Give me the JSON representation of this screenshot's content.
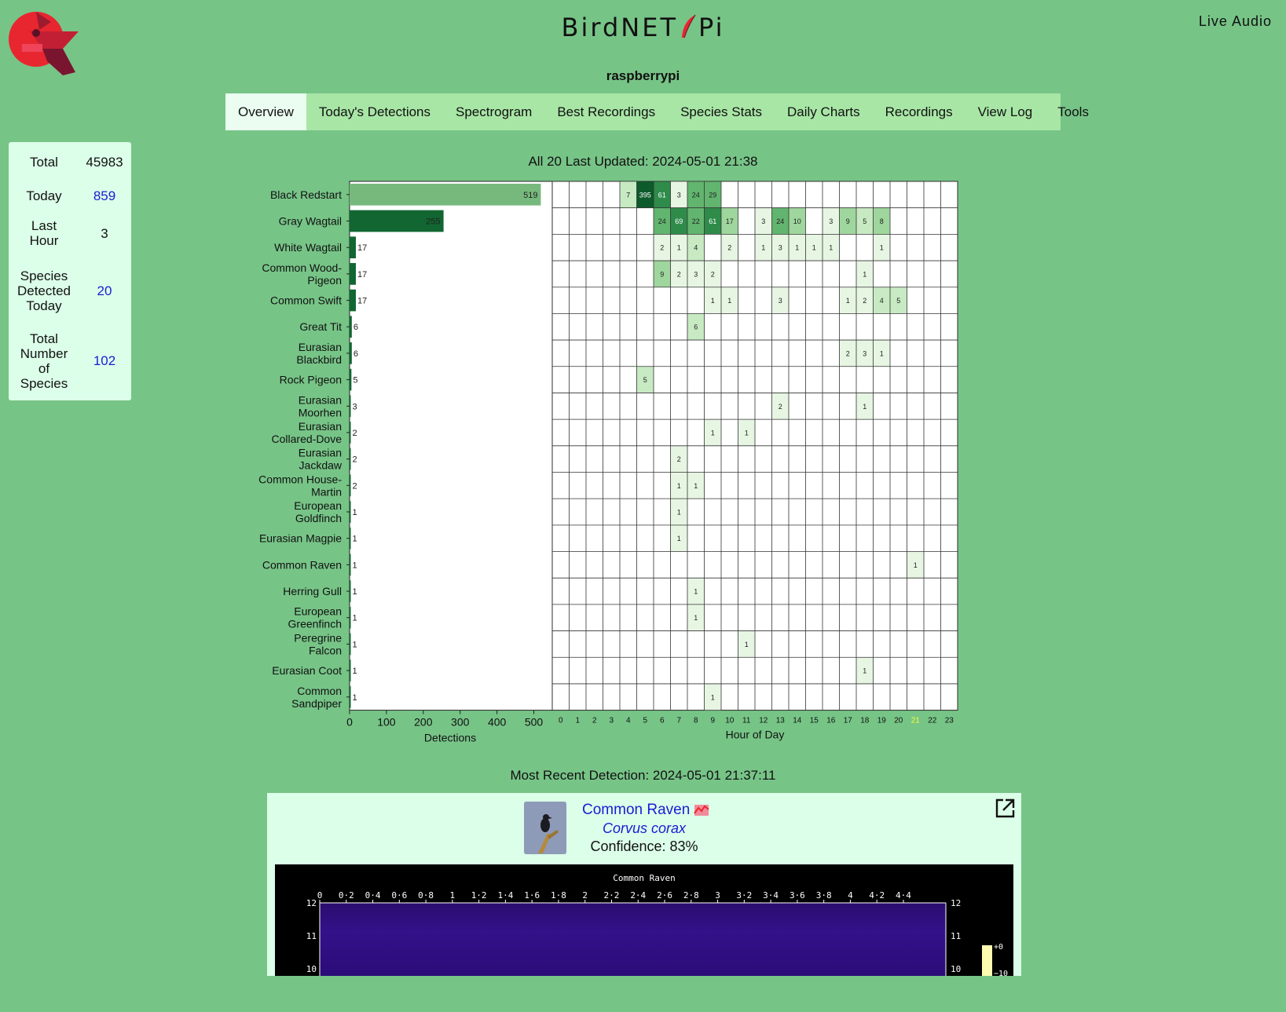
{
  "header": {
    "title_left": "BirdNET",
    "title_right": "Pi",
    "hostname": "raspberrypi",
    "live_audio": "Live Audio"
  },
  "nav": {
    "tabs": [
      "Overview",
      "Today's Detections",
      "Spectrogram",
      "Best Recordings",
      "Species Stats",
      "Daily Charts",
      "Recordings",
      "View Log",
      "Tools"
    ],
    "active": "Overview"
  },
  "stats": {
    "total_label": "Total",
    "total_value": "45983",
    "today_label": "Today",
    "today_value": "859",
    "last_hour_label_1": "Last",
    "last_hour_label_2": "Hour",
    "last_hour_value": "3",
    "species_today_label_1": "Species",
    "species_today_label_2": "Detected",
    "species_today_label_3": "Today",
    "species_today_value": "20",
    "total_species_label_1": "Total",
    "total_species_label_2": "Number",
    "total_species_label_3": "of",
    "total_species_label_4": "Species",
    "total_species_value": "102"
  },
  "chart_header": "All 20 Last Updated: 2024-05-01 21:38",
  "chart_data": {
    "type": "bar",
    "orientation": "horizontal",
    "categories": [
      [
        "Black Redstart"
      ],
      [
        "Gray Wagtail"
      ],
      [
        "White Wagtail"
      ],
      [
        "Common Wood-",
        "Pigeon"
      ],
      [
        "Common Swift"
      ],
      [
        "Great Tit"
      ],
      [
        "Eurasian",
        "Blackbird"
      ],
      [
        "Rock Pigeon"
      ],
      [
        "Eurasian",
        "Moorhen"
      ],
      [
        "Eurasian",
        "Collared-Dove"
      ],
      [
        "Eurasian",
        "Jackdaw"
      ],
      [
        "Common House-",
        "Martin"
      ],
      [
        "European",
        "Goldfinch"
      ],
      [
        "Eurasian Magpie"
      ],
      [
        "Common Raven"
      ],
      [
        "Herring Gull"
      ],
      [
        "European",
        "Greenfinch"
      ],
      [
        "Peregrine",
        "Falcon"
      ],
      [
        "Eurasian Coot"
      ],
      [
        "Common",
        "Sandpiper"
      ]
    ],
    "values": [
      519,
      255,
      17,
      17,
      17,
      6,
      6,
      5,
      3,
      2,
      2,
      2,
      1,
      1,
      1,
      1,
      1,
      1,
      1,
      1
    ],
    "xlabel": "Detections",
    "xlim": [
      0,
      550
    ],
    "xticks": [
      0,
      100,
      200,
      300,
      400,
      500
    ],
    "heatmap": {
      "xlabel": "Hour of Day",
      "hours": [
        0,
        1,
        2,
        3,
        4,
        5,
        6,
        7,
        8,
        9,
        10,
        11,
        12,
        13,
        14,
        15,
        16,
        17,
        18,
        19,
        20,
        21,
        22,
        23
      ],
      "highlight_hour": 21,
      "cells": [
        [
          [
            4,
            7
          ],
          [
            5,
            395
          ],
          [
            6,
            61
          ],
          [
            7,
            3
          ],
          [
            8,
            24
          ],
          [
            9,
            29
          ]
        ],
        [
          [
            6,
            24
          ],
          [
            7,
            69
          ],
          [
            8,
            22
          ],
          [
            9,
            61
          ],
          [
            10,
            17
          ],
          [
            12,
            3
          ],
          [
            13,
            24
          ],
          [
            14,
            10
          ],
          [
            16,
            3
          ],
          [
            17,
            9
          ],
          [
            18,
            5
          ],
          [
            19,
            8
          ]
        ],
        [
          [
            6,
            2
          ],
          [
            7,
            1
          ],
          [
            8,
            4
          ],
          [
            10,
            2
          ],
          [
            12,
            1
          ],
          [
            13,
            3
          ],
          [
            14,
            1
          ],
          [
            15,
            1
          ],
          [
            16,
            1
          ],
          [
            19,
            1
          ]
        ],
        [
          [
            6,
            9
          ],
          [
            7,
            2
          ],
          [
            8,
            3
          ],
          [
            9,
            2
          ],
          [
            18,
            1
          ]
        ],
        [
          [
            9,
            1
          ],
          [
            10,
            1
          ],
          [
            13,
            3
          ],
          [
            17,
            1
          ],
          [
            18,
            2
          ],
          [
            19,
            4
          ],
          [
            20,
            5
          ]
        ],
        [
          [
            8,
            6
          ]
        ],
        [
          [
            17,
            2
          ],
          [
            18,
            3
          ],
          [
            19,
            1
          ]
        ],
        [
          [
            5,
            5
          ]
        ],
        [
          [
            13,
            2
          ],
          [
            18,
            1
          ]
        ],
        [
          [
            9,
            1
          ],
          [
            11,
            1
          ]
        ],
        [
          [
            7,
            2
          ]
        ],
        [
          [
            7,
            1
          ],
          [
            8,
            1
          ]
        ],
        [
          [
            7,
            1
          ]
        ],
        [
          [
            7,
            1
          ]
        ],
        [
          [
            21,
            1
          ]
        ],
        [
          [
            8,
            1
          ]
        ],
        [
          [
            8,
            1
          ]
        ],
        [
          [
            11,
            1
          ]
        ],
        [
          [
            18,
            1
          ]
        ],
        [
          [
            9,
            1
          ]
        ]
      ]
    }
  },
  "recent": {
    "label": "Most Recent Detection: 2024-05-01 21:37:11",
    "species": "Common Raven",
    "scientific": "Corvus corax",
    "confidence": "Confidence: 83%",
    "spectrogram_title": "Common Raven",
    "spectrogram_xticks": [
      "0",
      "0·2",
      "0·4",
      "0·6",
      "0·8",
      "1",
      "1·2",
      "1·4",
      "1·6",
      "1·8",
      "2",
      "2·2",
      "2·4",
      "2·6",
      "2·8",
      "3",
      "3·2",
      "3·4",
      "3·6",
      "3·8",
      "4",
      "4·2",
      "4·4"
    ],
    "spectrogram_yticks": [
      "12",
      "11",
      "10"
    ],
    "colorbar_ticks": [
      "+0",
      "−10"
    ]
  },
  "colors": {
    "background": "#77c487",
    "nav": "#a8e6a6",
    "panel": "#dcffe9",
    "link": "#1b1bd4",
    "bar_top": "#77b97d",
    "bar_dark": "#116631",
    "logo": "#e8262f"
  }
}
